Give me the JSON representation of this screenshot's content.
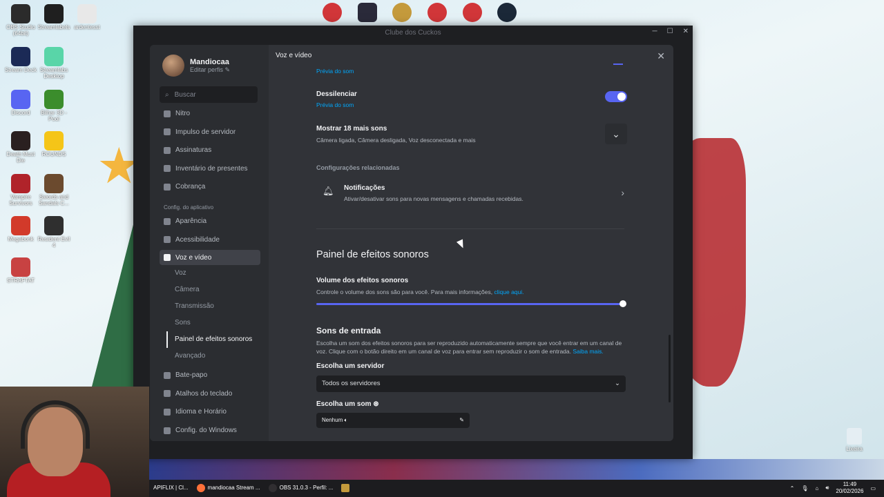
{
  "desktop": {
    "icons": [
      {
        "label": "OBS Studio (64bit)",
        "color": "#2b2b2b"
      },
      {
        "label": "Streamlabels",
        "color": "#1f1f1f"
      },
      {
        "label": "ardentesst",
        "color": "#e8e8e8"
      },
      {
        "label": "Stream Deck",
        "color": "#1b2a56"
      },
      {
        "label": "Streamlabs Desktop",
        "color": "#59d5a8"
      },
      {
        "label": "Discord",
        "color": "#5865f2"
      },
      {
        "label": "Bilhar 3D - Pool",
        "color": "#3b8d2c"
      },
      {
        "label": "Death Must Die",
        "color": "#2a2020"
      },
      {
        "label": "ROUNDS",
        "color": "#f5c518"
      },
      {
        "label": "Vampire Survivors",
        "color": "#b0232a"
      },
      {
        "label": "Swords and Sandals C...",
        "color": "#6b4a2e"
      },
      {
        "label": "Megabonk",
        "color": "#d23a2a"
      },
      {
        "label": "Resident Evil 4",
        "color": "#2f2f2f"
      },
      {
        "label": "STRAFTAT",
        "color": "#c84242"
      }
    ],
    "recycle_label": "Lixeira"
  },
  "window": {
    "title": "Clube dos Cuckos"
  },
  "profile": {
    "name": "Mandiocaa",
    "edit": "Editar perfis"
  },
  "search": {
    "placeholder": "Buscar"
  },
  "nav": {
    "top": [
      "Nitro",
      "Impulso de servidor",
      "Assinaturas",
      "Inventário de presentes",
      "Cobrança"
    ],
    "app_heading": "Config. do aplicativo",
    "app": [
      "Aparência",
      "Acessibilidade"
    ],
    "active": "Voz e vídeo",
    "sub": [
      "Voz",
      "Câmera",
      "Transmissão",
      "Sons",
      "Painel de efeitos sonoros",
      "Avançado"
    ],
    "bottom": [
      "Bate-papo",
      "Atalhos do teclado",
      "Idioma e Horário",
      "Config. do Windows"
    ]
  },
  "content": {
    "title": "Voz e vídeo",
    "preview_link": "Prévia do som",
    "dessilenciar": {
      "label": "Dessilenciar",
      "preview": "Prévia do som",
      "enabled": true
    },
    "more_sounds": {
      "label": "Mostrar 18 mais sons",
      "desc": "Câmera ligada, Câmera desligada, Voz desconectada e mais"
    },
    "related_heading": "Configurações relacionadas",
    "notifications": {
      "label": "Notificações",
      "desc": "Ativar/desativar sons para novas mensagens e chamadas recebidas."
    },
    "soundboard_title": "Painel de efeitos sonoros",
    "volume": {
      "label": "Volume dos efeitos sonoros",
      "desc": "Controle o volume dos sons são para você. Para mais informações,",
      "link": "clique aqui.",
      "value": 1.0
    },
    "entry_sounds": {
      "title": "Sons de entrada",
      "desc": "Escolha um som dos efeitos sonoros para ser reproduzido automaticamente sempre que você entrar em um canal de voz. Clique com o botão direito em um canal de voz para entrar sem reproduzir o som de entrada.",
      "link": "Saiba mais.",
      "server_label": "Escolha um servidor",
      "server_value": "Todos os servidores",
      "sound_label": "Escolha um som",
      "sound_value": "Nenhum"
    }
  },
  "taskbar": {
    "tasks": [
      "APIFLIX | Cl...",
      "mandiocaa Stream ...",
      "OBS 31.0.3 - Perfil: ..."
    ],
    "time": "11:49",
    "date": "20/02/2026"
  }
}
